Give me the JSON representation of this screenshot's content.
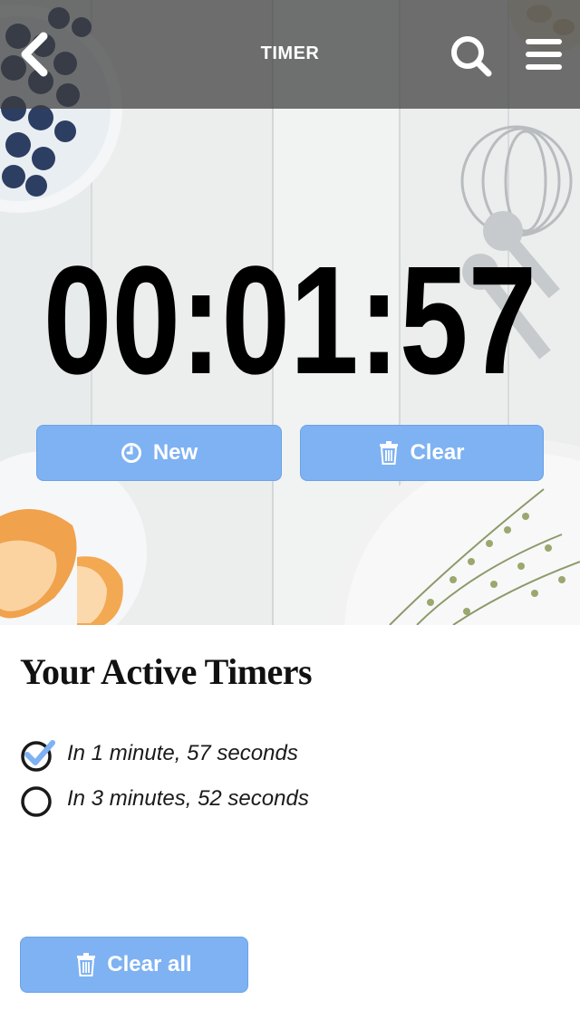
{
  "header": {
    "title": "TIMER",
    "back_icon": "chevron-left-icon",
    "search_icon": "search-icon",
    "menu_icon": "hamburger-menu-icon"
  },
  "clock": {
    "display": "00:01:57"
  },
  "actions": {
    "new_label": "New",
    "new_icon": "clock-icon",
    "clear_label": "Clear",
    "clear_icon": "trash-icon"
  },
  "active_timers": {
    "heading": "Your Active Timers",
    "items": [
      {
        "label": "In 1 minute, 57 seconds",
        "checked": true
      },
      {
        "label": "In 3 minutes, 52 seconds",
        "checked": false
      }
    ],
    "clear_all_label": "Clear all",
    "clear_all_icon": "trash-icon"
  },
  "colors": {
    "accent": "#7eb2f2",
    "topbar": "#3c3c3c",
    "check": "#7eb2f2",
    "text": "#111111"
  }
}
